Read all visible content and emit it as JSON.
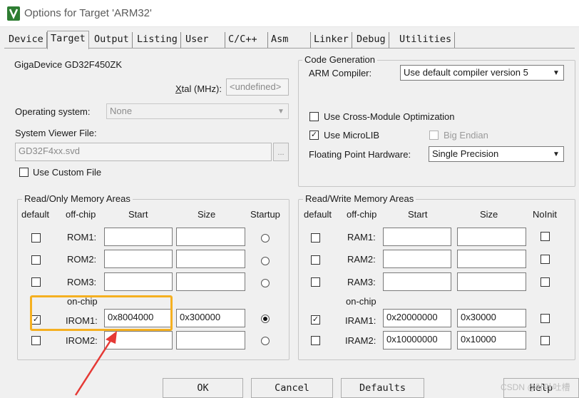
{
  "window": {
    "title": "Options for Target 'ARM32'"
  },
  "tabs": [
    "Device",
    "Target",
    "Output",
    "Listing",
    "User",
    "C/C++",
    "Asm",
    "Linker",
    "Debug",
    "Utilities"
  ],
  "active_tab": "Target",
  "device_name": "GigaDevice GD32F450ZK",
  "xtal": {
    "label_prefix": "",
    "label_key": "X",
    "label_rest": "tal (MHz):",
    "value": "<undefined>"
  },
  "os": {
    "label": "Operating system:",
    "value": "None"
  },
  "svd": {
    "label": "System Viewer File:",
    "value": "GD32F4xx.svd",
    "browse": "..."
  },
  "custom_file": {
    "label": "Use Custom File",
    "checked": false
  },
  "code_gen": {
    "title": "Code Generation",
    "compiler_label": "ARM Compiler:",
    "compiler_value": "Use default compiler version 5",
    "cross_module": {
      "label": "Use Cross-Module Optimization",
      "checked": false
    },
    "microlib": {
      "label": "Use MicroLIB",
      "checked": true
    },
    "big_endian": {
      "label": "Big Endian",
      "checked": false
    },
    "fpu_label": "Floating Point Hardware:",
    "fpu_value": "Single Precision"
  },
  "ro_memory": {
    "title": "Read/Only Memory Areas",
    "headers": {
      "default": "default",
      "offchip": "off-chip",
      "start": "Start",
      "size": "Size",
      "startup": "Startup"
    },
    "onchip_label": "on-chip",
    "rows": [
      {
        "name": "ROM1:",
        "default": false,
        "start": "",
        "size": "",
        "startup": false
      },
      {
        "name": "ROM2:",
        "default": false,
        "start": "",
        "size": "",
        "startup": false
      },
      {
        "name": "ROM3:",
        "default": false,
        "start": "",
        "size": "",
        "startup": false
      },
      {
        "name": "IROM1:",
        "default": true,
        "start": "0x8004000",
        "size": "0x300000",
        "startup": true
      },
      {
        "name": "IROM2:",
        "default": false,
        "start": "",
        "size": "",
        "startup": false
      }
    ]
  },
  "rw_memory": {
    "title": "Read/Write Memory Areas",
    "headers": {
      "default": "default",
      "offchip": "off-chip",
      "start": "Start",
      "size": "Size",
      "noinit": "NoInit"
    },
    "onchip_label": "on-chip",
    "rows": [
      {
        "name": "RAM1:",
        "default": false,
        "start": "",
        "size": "",
        "noinit": false
      },
      {
        "name": "RAM2:",
        "default": false,
        "start": "",
        "size": "",
        "noinit": false
      },
      {
        "name": "RAM3:",
        "default": false,
        "start": "",
        "size": "",
        "noinit": false
      },
      {
        "name": "IRAM1:",
        "default": true,
        "start": "0x20000000",
        "size": "0x30000",
        "noinit": false
      },
      {
        "name": "IRAM2:",
        "default": false,
        "start": "0x10000000",
        "size": "0x10000",
        "noinit": false
      }
    ]
  },
  "buttons": {
    "ok": "OK",
    "cancel": "Cancel",
    "defaults": "Defaults",
    "help": "Help"
  },
  "watermark": "CSDN @叶叶吐槽",
  "colors": {
    "highlight": "#f5b021",
    "arrow": "#e53935"
  }
}
